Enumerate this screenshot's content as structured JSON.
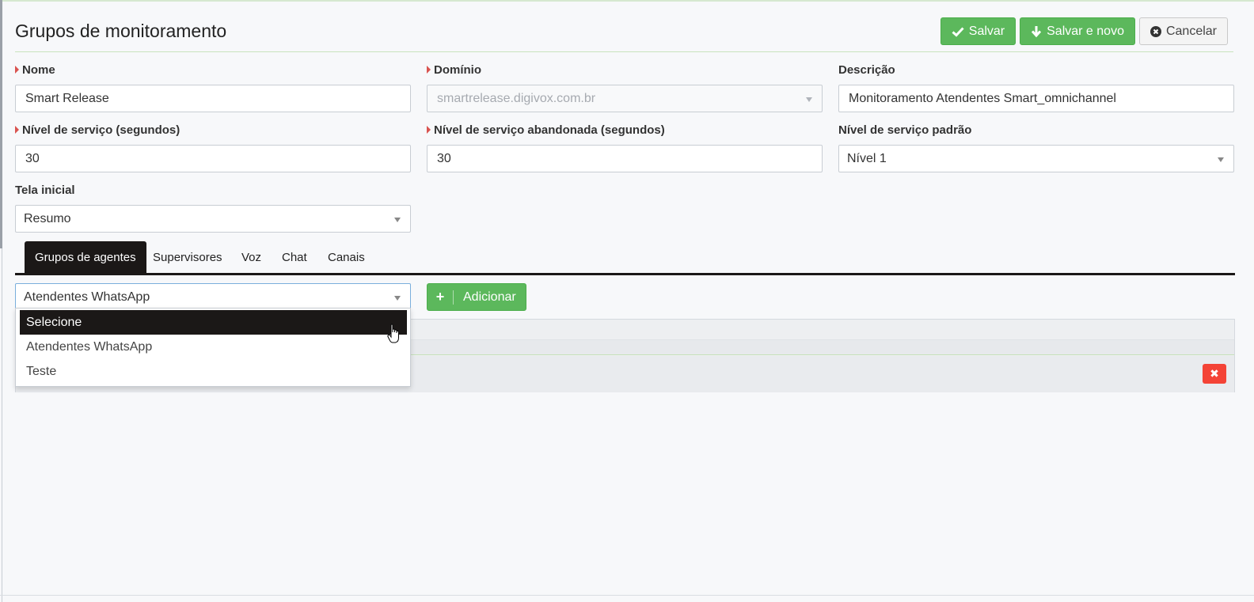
{
  "header": {
    "title": "Grupos de monitoramento",
    "save_label": "Salvar",
    "save_new_label": "Salvar e novo",
    "cancel_label": "Cancelar"
  },
  "form": {
    "nome": {
      "label": "Nome",
      "value": "Smart Release"
    },
    "dominio": {
      "label": "Domínio",
      "value": "smartrelease.digivox.com.br"
    },
    "descricao": {
      "label": "Descrição",
      "value": "Monitoramento Atendentes Smart_omnichannel"
    },
    "nivel_servico": {
      "label": "Nível de serviço (segundos)",
      "value": "30"
    },
    "nivel_abandonada": {
      "label": "Nível de serviço abandonada (segundos)",
      "value": "30"
    },
    "nivel_padrao": {
      "label": "Nível de serviço padrão",
      "value": "Nível 1"
    },
    "tela_inicial": {
      "label": "Tela inicial",
      "value": "Resumo"
    }
  },
  "tabs": [
    {
      "label": "Grupos de agentes",
      "active": true
    },
    {
      "label": "Supervisores"
    },
    {
      "label": "Voz"
    },
    {
      "label": "Chat"
    },
    {
      "label": "Canais"
    }
  ],
  "agent_group": {
    "selected": "Atendentes WhatsApp",
    "add_label": "Adicionar",
    "options": [
      "Selecione",
      "Atendentes WhatsApp",
      "Teste"
    ],
    "highlighted_option": "Selecione"
  },
  "icons": {
    "save": "check-icon",
    "save_new": "arrow-down-icon",
    "cancel": "times-circle-icon",
    "add": "plus-icon",
    "delete": "times-icon",
    "cursor": "hand-pointer-icon"
  },
  "colors": {
    "success": "#5cb85c",
    "danger": "#f44336",
    "dark": "#1b1817",
    "required": "#d9534f"
  }
}
